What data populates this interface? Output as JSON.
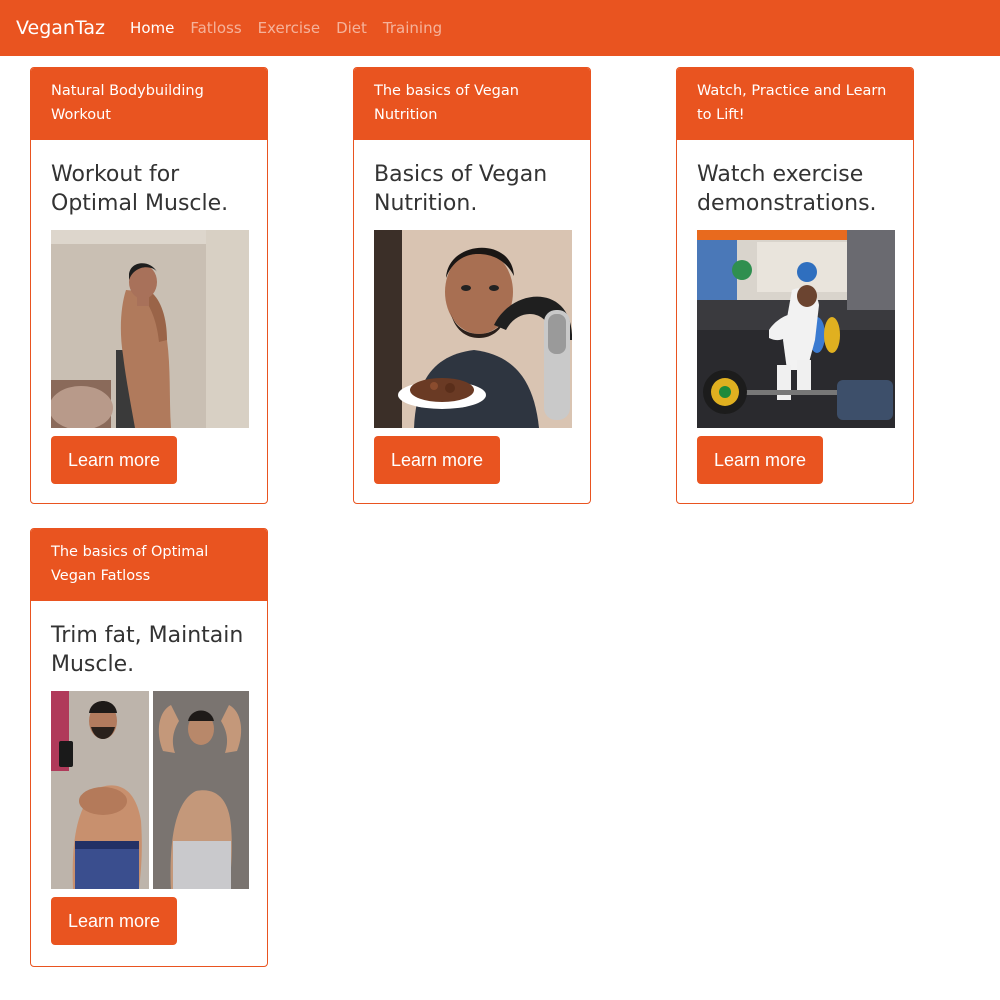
{
  "navbar": {
    "brand": "VeganTaz",
    "links": [
      {
        "label": "Home",
        "active": true
      },
      {
        "label": "Fatloss",
        "active": false
      },
      {
        "label": "Exercise",
        "active": false
      },
      {
        "label": "Diet",
        "active": false
      },
      {
        "label": "Training",
        "active": false
      }
    ]
  },
  "cards": [
    {
      "header": "Natural Bodybuilding Workout",
      "title": "Workout for Optimal Muscle.",
      "image": "side-profile-physique-photo",
      "button": "Learn more"
    },
    {
      "header": "The basics of Vegan Nutrition",
      "title": "Basics of Vegan Nutrition.",
      "image": "man-with-food-and-microphone-photo",
      "button": "Learn more"
    },
    {
      "header": "Watch, Practice and Learn to Lift!",
      "title": "Watch exercise demonstrations.",
      "image": "gym-deadlift-photo",
      "button": "Learn more"
    },
    {
      "header": "The basics of Optimal Vegan Fatloss",
      "title": "Trim fat, Maintain Muscle.",
      "image": "before-after-fatloss-photo",
      "button": "Learn more"
    }
  ],
  "colors": {
    "accent": "#e95420",
    "text": "#333333",
    "background": "#ffffff"
  }
}
